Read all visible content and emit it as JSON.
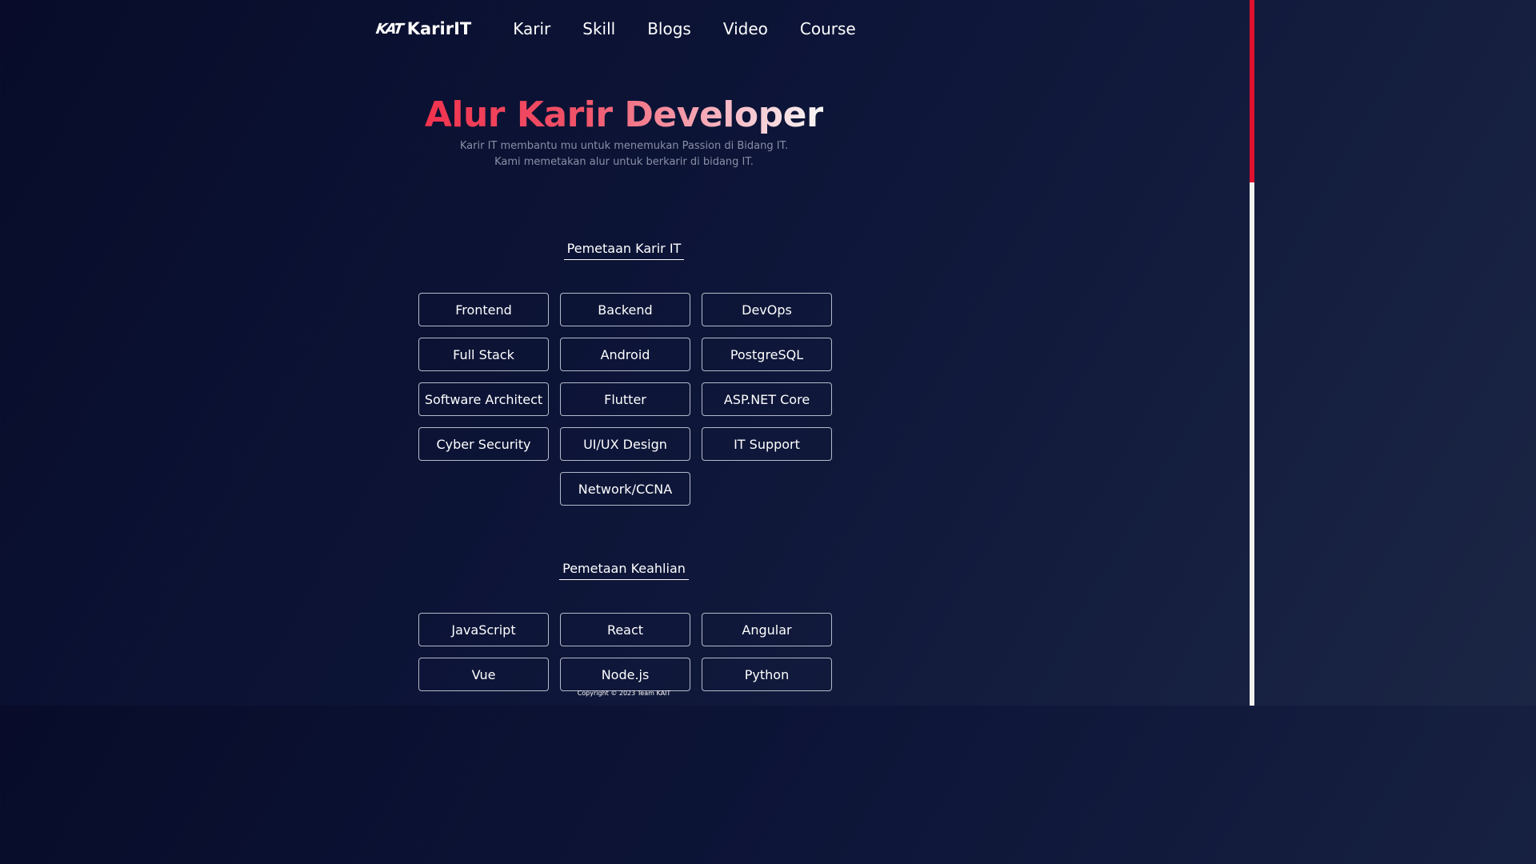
{
  "nav": {
    "logo_mark": "KAT",
    "brand": "KarirIT",
    "links": [
      "Karir",
      "Skill",
      "Blogs",
      "Video",
      "Course"
    ]
  },
  "hero": {
    "title": "Alur Karir Developer",
    "subtitle_line1": "Karir IT membantu mu untuk menemukan Passion di Bidang IT.",
    "subtitle_line2": "Kami memetakan alur untuk berkarir di bidang IT."
  },
  "career_section": {
    "title": "Pemetaan Karir IT",
    "items": [
      "Frontend",
      "Backend",
      "DevOps",
      "Full Stack",
      "Android",
      "PostgreSQL",
      "Software Architect",
      "Flutter",
      "ASP.NET Core",
      "Cyber Security",
      "UI/UX Design",
      "IT Support",
      "Network/CCNA"
    ]
  },
  "skill_section": {
    "title": "Pemetaan Keahlian",
    "items": [
      "JavaScript",
      "React",
      "Angular",
      "Vue",
      "Node.js",
      "Python"
    ]
  },
  "footer": {
    "copyright": "Copyright © 2023 Team KAIT"
  },
  "colors": {
    "accent": "#f0334f",
    "background": "#0d1538",
    "scrollbar_thumb": "#e0102f"
  }
}
